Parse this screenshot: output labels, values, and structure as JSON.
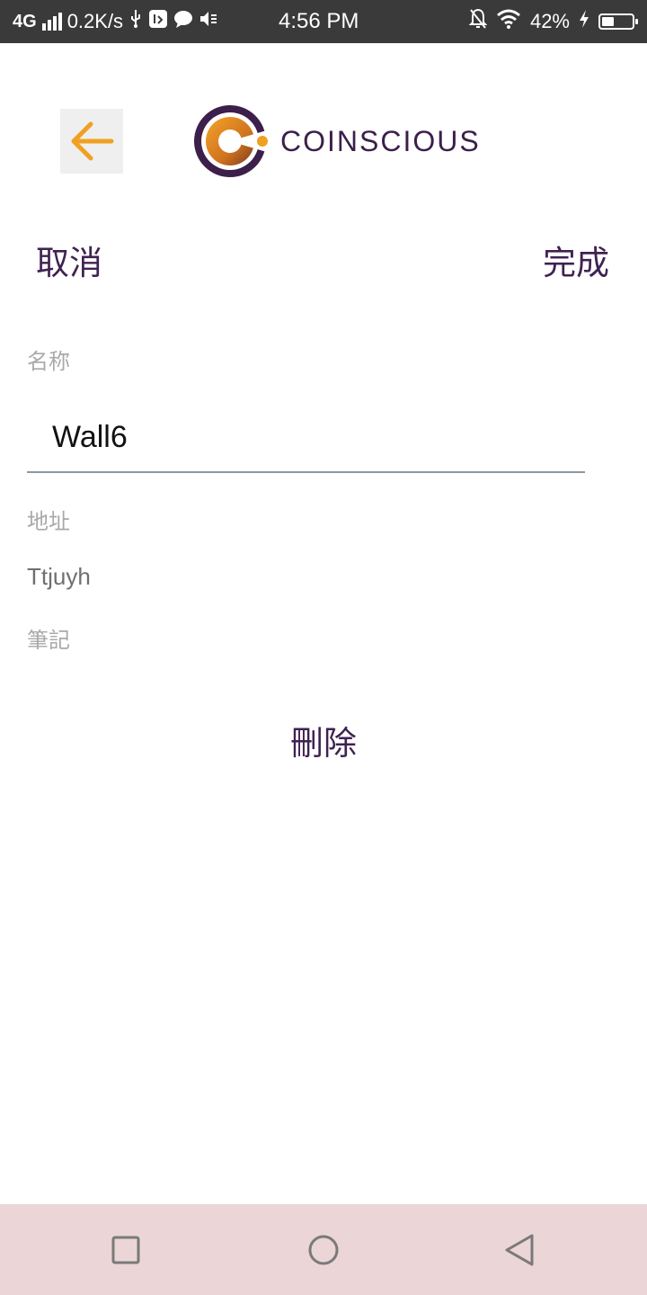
{
  "status_bar": {
    "network": "4G",
    "speed": "0.2K/s",
    "time": "4:56 PM",
    "battery": "42%",
    "battery_level": 0.42,
    "icons": [
      "signal-icon",
      "usb-icon",
      "usb-debug-icon",
      "chat-icon",
      "mute-icon",
      "bell-off-icon",
      "wifi-icon",
      "charging-icon",
      "battery-icon"
    ]
  },
  "header": {
    "back_icon": "arrow-left-icon",
    "logo_text": "COINSCIOUS",
    "accent_color": "#f0a022",
    "brand_color": "#3c1f4a"
  },
  "actions": {
    "cancel_label": "取消",
    "done_label": "完成"
  },
  "form": {
    "name_label": "名称",
    "name_value": "Wall6",
    "address_label": "地址",
    "address_value": "Ttjuyh",
    "note_label": "筆記"
  },
  "delete_label": "刪除",
  "nav": {
    "recents_icon": "square-icon",
    "home_icon": "circle-icon",
    "back_icon": "triangle-back-icon"
  }
}
